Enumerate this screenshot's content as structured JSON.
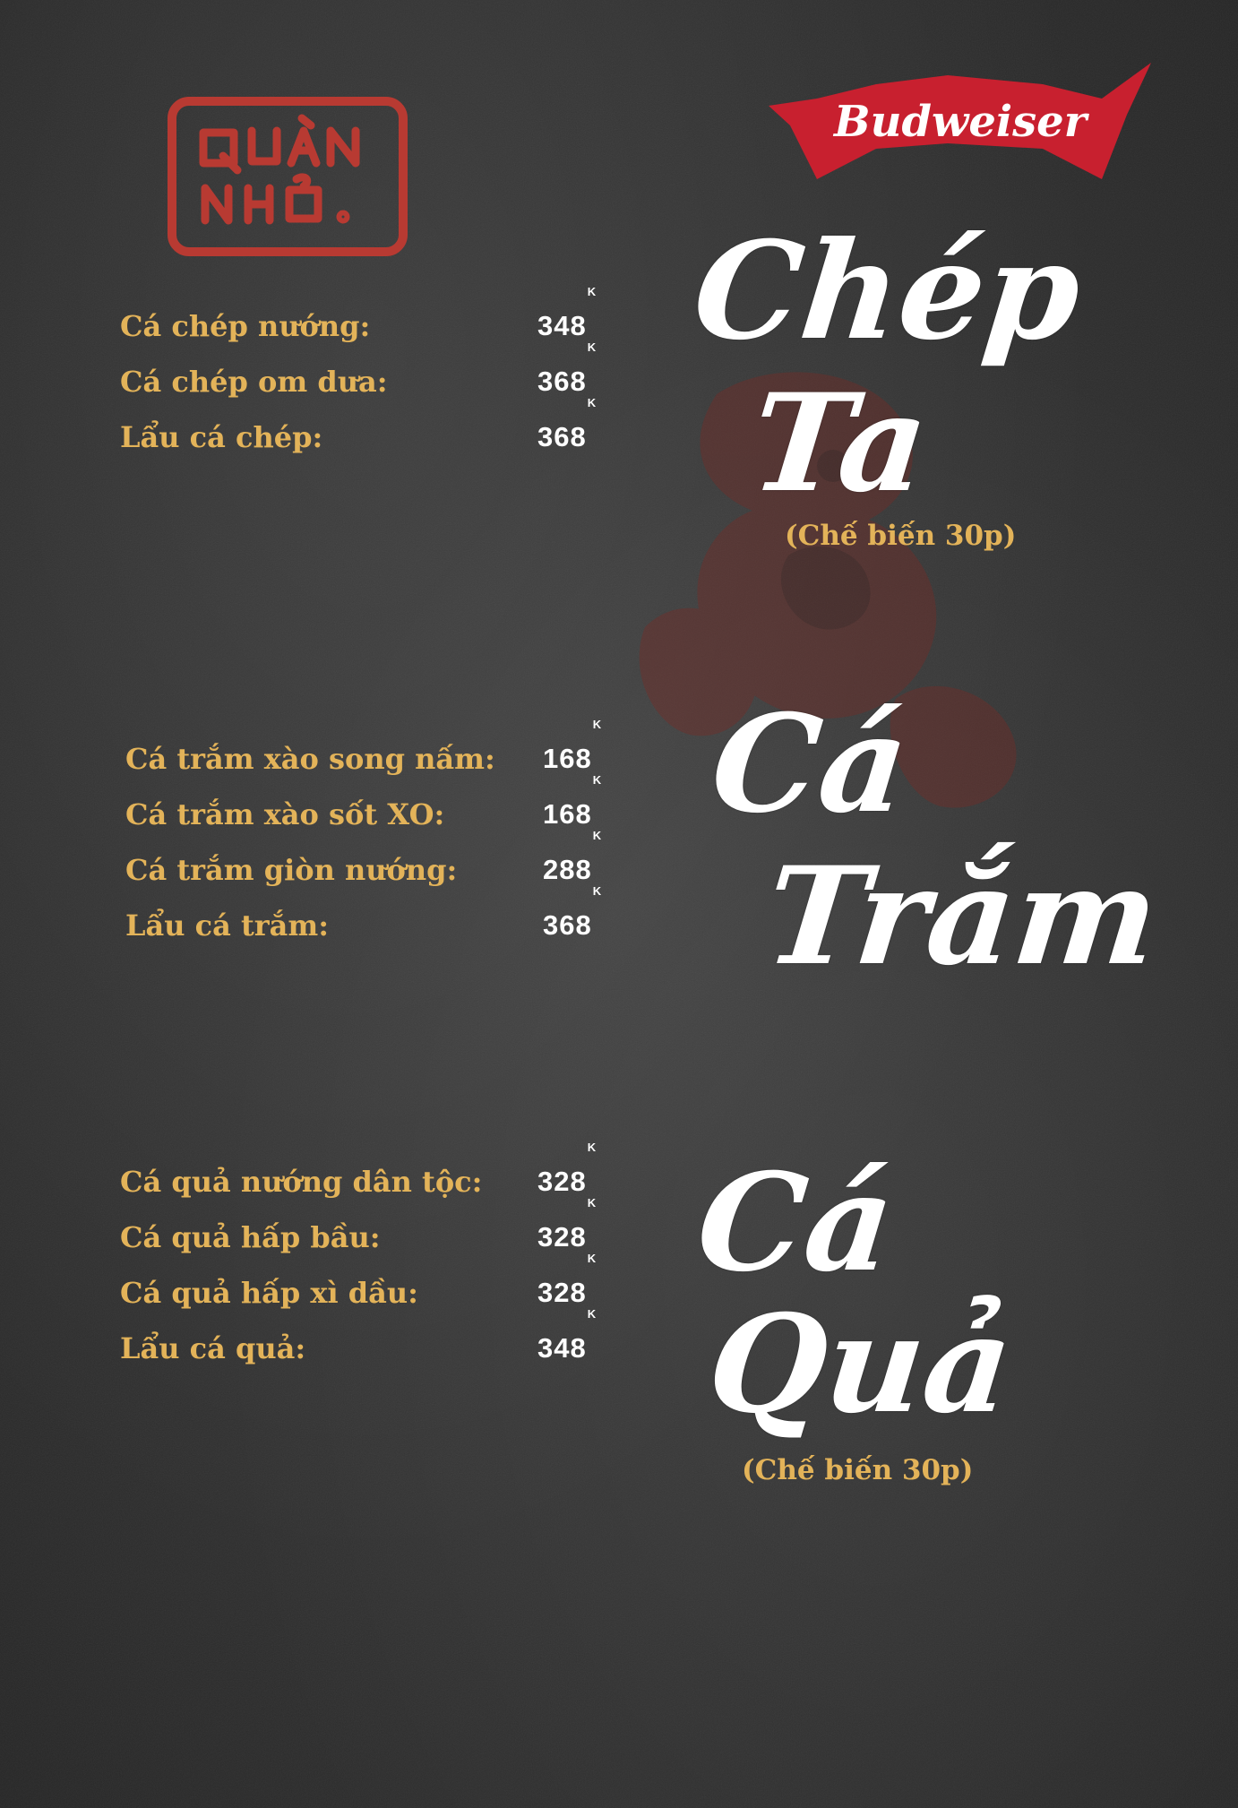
{
  "brand": {
    "logo_text": "QUÁN NHỎ.",
    "sponsor": "Budweiser"
  },
  "colors": {
    "background": "#2f2f2f",
    "item_name": "#e3b359",
    "price": "#ffffff",
    "title": "#ffffff",
    "stamp_red": "#b83a32",
    "budweiser_red": "#c8202f"
  },
  "sections": {
    "chep": {
      "title_line1": "Chép",
      "title_line2": "Ta",
      "note": "(Chế biến 30p)",
      "items": [
        {
          "name": "Cá chép nướng:",
          "price": "348",
          "unit": "K"
        },
        {
          "name": "Cá chép om dưa:",
          "price": "368",
          "unit": "K"
        },
        {
          "name": "Lẩu cá chép:",
          "price": "368",
          "unit": "K"
        }
      ]
    },
    "tram": {
      "title_line1": "Cá",
      "title_line2": "Trắm",
      "items": [
        {
          "name": "Cá trắm xào song nấm:",
          "price": "168",
          "unit": "K"
        },
        {
          "name": "Cá trắm xào sốt XO:",
          "price": "168",
          "unit": "K"
        },
        {
          "name": "Cá trắm giòn nướng:",
          "price": "288",
          "unit": "K"
        },
        {
          "name": "Lẩu cá trắm:",
          "price": "368",
          "unit": "K"
        }
      ]
    },
    "qua": {
      "title_line1": "Cá",
      "title_line2": "Quả",
      "note": "(Chế biến 30p)",
      "items": [
        {
          "name": "Cá quả nướng dân tộc:",
          "price": "328",
          "unit": "K"
        },
        {
          "name": "Cá quả hấp bầu:",
          "price": "328",
          "unit": "K"
        },
        {
          "name": "Cá quả hấp xì dầu:",
          "price": "328",
          "unit": "K"
        },
        {
          "name": "Lẩu cá quả:",
          "price": "348",
          "unit": "K"
        }
      ]
    }
  }
}
